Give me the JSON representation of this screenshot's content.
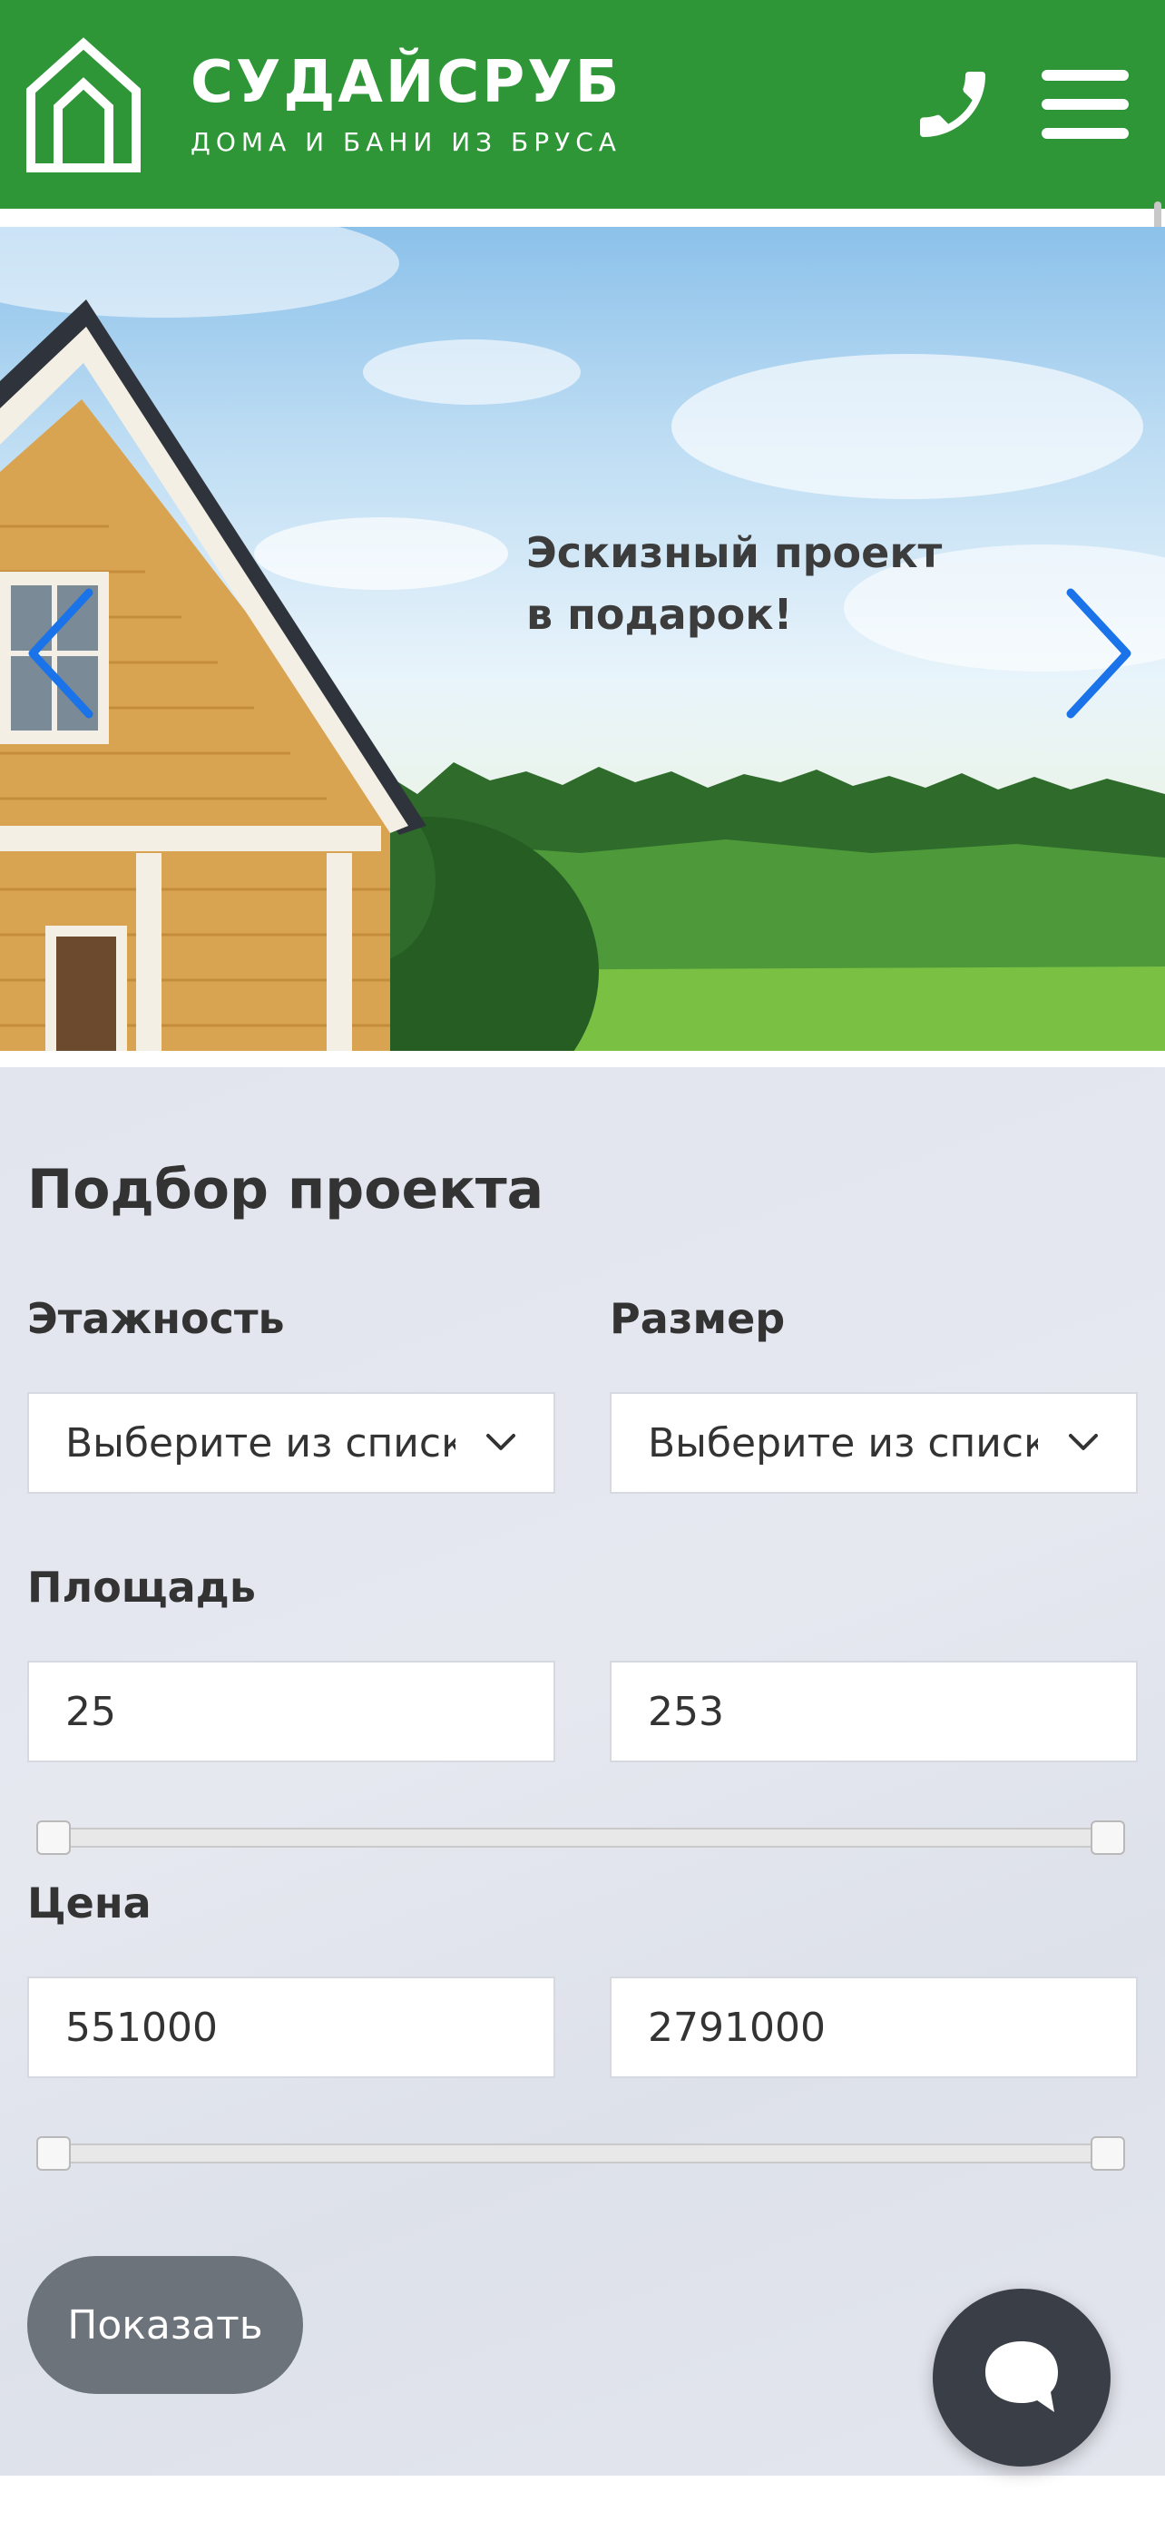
{
  "colors": {
    "header_bg": "#2e9637",
    "slider_arrow": "#1a73e8",
    "button_bg": "#6c737b",
    "chat_bg": "#3a3f47"
  },
  "header": {
    "brand_name": "СУДАЙСРУБ",
    "brand_tagline": "ДОМА И БАНИ ИЗ БРУСА",
    "logo_icon": "house-outline-icon",
    "phone_icon": "phone-icon",
    "menu_icon": "hamburger-menu-icon"
  },
  "hero": {
    "line1": "Эскизный проект",
    "line2": "в подарок!",
    "prev_icon": "chevron-left-icon",
    "next_icon": "chevron-right-icon"
  },
  "filter": {
    "title": "Подбор проекта",
    "floors_label": "Этажность",
    "floors_value": "Выберите из списка",
    "size_label": "Размер",
    "size_value": "Выберите из списка",
    "area_label": "Площадь",
    "area_min": "25",
    "area_max": "253",
    "price_label": "Цена",
    "price_min": "551000",
    "price_max": "2791000",
    "area_range": {
      "from_fraction": 0,
      "to_fraction": 1
    },
    "price_range": {
      "from_fraction": 0,
      "to_fraction": 1
    },
    "show_button": "Показать"
  },
  "chat": {
    "icon": "chat-bubble-icon"
  }
}
